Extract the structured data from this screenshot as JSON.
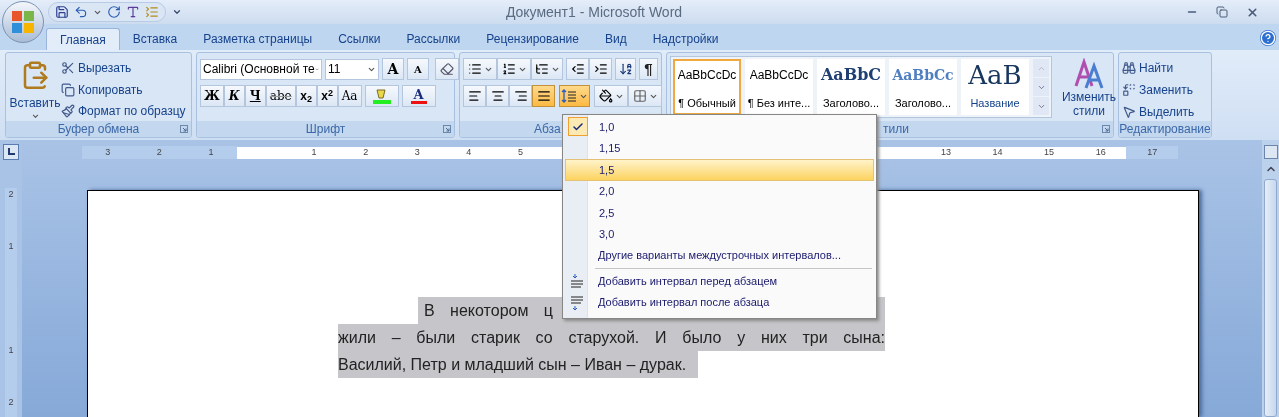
{
  "window": {
    "title": "Документ1 - Microsoft Word"
  },
  "tabs": [
    {
      "label": "Главная",
      "selected": true
    },
    {
      "label": "Вставка",
      "selected": false
    },
    {
      "label": "Разметка страницы",
      "selected": false
    },
    {
      "label": "Ссылки",
      "selected": false
    },
    {
      "label": "Рассылки",
      "selected": false
    },
    {
      "label": "Рецензирование",
      "selected": false
    },
    {
      "label": "Вид",
      "selected": false
    },
    {
      "label": "Надстройки",
      "selected": false
    }
  ],
  "clipboard": {
    "label": "Буфер обмена",
    "paste": "Вставить",
    "items": [
      {
        "kind": "cut",
        "label": "Вырезать"
      },
      {
        "kind": "copy",
        "label": "Копировать"
      },
      {
        "kind": "painter",
        "label": "Формат по образцу"
      }
    ]
  },
  "font": {
    "label": "Шрифт",
    "font_name": "Calibri (Основной те",
    "font_size": "11",
    "grow": "A",
    "shrink": "A",
    "font_color": "A",
    "format_buttons": [
      {
        "kind": "bold",
        "label": "Ж"
      },
      {
        "kind": "italic",
        "label": "К"
      },
      {
        "kind": "underline",
        "label": "Ч"
      },
      {
        "kind": "strike",
        "label": "abe"
      },
      {
        "kind": "sub",
        "label": "x$_{2}$"
      },
      {
        "kind": "sup",
        "label": "x$^{2}$"
      },
      {
        "kind": "case",
        "label": "Aa"
      }
    ]
  },
  "paragraph": {
    "label": "Абза",
    "pilcrow": "¶",
    "line_spacing_open": true,
    "align": [
      {
        "kind": "left",
        "selected": false
      },
      {
        "kind": "center",
        "selected": false
      },
      {
        "kind": "right",
        "selected": false
      },
      {
        "kind": "justify",
        "selected": true
      }
    ]
  },
  "styles": {
    "label": "тили",
    "change": "Изменить стили",
    "items": [
      {
        "kind": "normal",
        "preview": "AaBbCcDc",
        "name": "¶ Обычный",
        "selected": true
      },
      {
        "kind": "normal",
        "preview": "AaBbCcDc",
        "name": "¶ Без инте...",
        "selected": false
      },
      {
        "kind": "heading1",
        "preview": "AaBbC",
        "name": "Заголово...",
        "selected": false
      },
      {
        "kind": "heading2",
        "preview": "AaBbCc",
        "name": "Заголово...",
        "selected": false
      },
      {
        "kind": "title",
        "preview": "AaB",
        "name": "Название",
        "selected": false
      }
    ]
  },
  "editing": {
    "label": "Редактирование",
    "items": [
      {
        "kind": "find",
        "label": "Найти"
      },
      {
        "kind": "replace",
        "label": "Заменить"
      },
      {
        "kind": "select",
        "label": "Выделить"
      }
    ]
  },
  "ruler": {
    "left_labels": [
      "3",
      "2",
      "1"
    ],
    "center_labels": [
      "1",
      "2",
      "3",
      "4",
      "5"
    ],
    "right_labels": [
      "13",
      "14",
      "15",
      "16",
      "17"
    ]
  },
  "vertical_ruler": [
    "2",
    "1",
    "1",
    "2"
  ],
  "document": {
    "lines": [
      "В некотором ц",
      "жили – были старик со старухой. И было у них три сына:",
      "Василий, Петр и младший сын – Иван – дурак."
    ]
  },
  "line_spacing_menu": {
    "more": "Другие варианты междустрочных интервалов...",
    "options": [
      {
        "label": "1,0",
        "checked": true,
        "selected": false
      },
      {
        "label": "1,15",
        "checked": false,
        "selected": false
      },
      {
        "label": "1,5",
        "checked": false,
        "selected": true
      },
      {
        "label": "2,0",
        "checked": false,
        "selected": false
      },
      {
        "label": "2,5",
        "checked": false,
        "selected": false
      },
      {
        "label": "3,0",
        "checked": false,
        "selected": false
      }
    ],
    "actions": [
      {
        "kind": "before",
        "label": "Добавить интервал перед абзацем"
      },
      {
        "kind": "after",
        "label": "Добавить интервал после абзаца"
      }
    ]
  }
}
